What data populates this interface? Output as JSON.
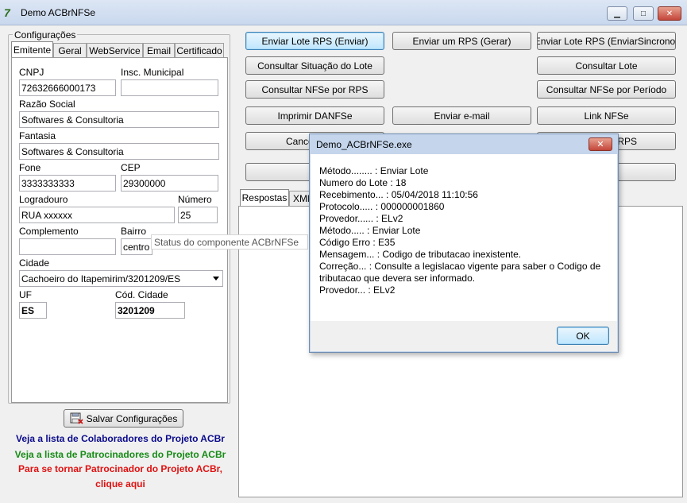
{
  "window": {
    "title": "Demo ACBrNFSe",
    "minimize": "▁",
    "maximize": "□",
    "close": "✕",
    "icon_glyph": "7"
  },
  "config": {
    "group_title": "Configurações",
    "tabs": [
      "Emitente",
      "Geral",
      "WebService",
      "Email",
      "Certificado"
    ],
    "labels": {
      "cnpj": "CNPJ",
      "insc_municipal": "Insc. Municipal",
      "razao_social": "Razão Social",
      "fantasia": "Fantasia",
      "fone": "Fone",
      "cep": "CEP",
      "logradouro": "Logradouro",
      "numero": "Número",
      "complemento": "Complemento",
      "bairro": "Bairro",
      "cidade": "Cidade",
      "uf": "UF",
      "cod_cidade": "Cód. Cidade"
    },
    "values": {
      "cnpj": "72632666000173",
      "insc_municipal": "",
      "razao_social": "Softwares & Consultoria",
      "fantasia": "Softwares & Consultoria",
      "fone": "3333333333",
      "cep": "29300000",
      "logradouro": "RUA xxxxxx",
      "numero": "25",
      "complemento": "",
      "bairro": "centro",
      "cidade": "Cachoeiro do Itapemirim/3201209/ES",
      "uf": "ES",
      "cod_cidade": "3201209"
    },
    "save_button": "Salvar Configurações"
  },
  "links": {
    "colaboradores": "Veja a lista de Colaboradores do Projeto ACBr",
    "patrocinadores": "Veja a lista de Patrocinadores do Projeto ACBr",
    "tornar_1": "Para se tornar Patrocinador do Projeto ACBr,",
    "tornar_2": "clique aqui"
  },
  "actions": {
    "enviar_lote": "Enviar Lote RPS (Enviar)",
    "enviar_um": "Enviar um RPS (Gerar)",
    "enviar_sincrono": "Enviar Lote RPS (EnviarSincrono)",
    "consultar_situacao": "Consultar Situação do Lote",
    "consultar_lote": "Consultar Lote",
    "consultar_nfse_rps": "Consultar NFSe por RPS",
    "consultar_nfse_periodo": "Consultar NFSe por Período",
    "imprimir_danfse": "Imprimir DANFSe",
    "enviar_email": "Enviar e-mail",
    "link_nfse": "Link NFSe",
    "cancelar_partial": "Cance",
    "rps_partial": "RPS"
  },
  "response_tabs": {
    "respostas": "Respostas",
    "xml_partial": "XMl"
  },
  "tooltip": "Status do componente ACBrNFSe",
  "dialog": {
    "title": "Demo_ACBrNFSe.exe",
    "close": "✕",
    "lines": [
      "Método........ : Enviar Lote",
      "Numero do Lote : 18",
      "Recebimento... : 05/04/2018 11:10:56",
      "Protocolo..... : 000000001860",
      "Provedor...... : ELv2",
      "Método..... : Enviar Lote",
      "Código Erro : E35",
      "Mensagem... : Codigo de tributacao inexistente.",
      "Correção... : Consulte a legislacao vigente para saber o Codigo de",
      "tributacao que devera ser informado.",
      "Provedor... : ELv2"
    ],
    "ok_button": "OK"
  },
  "colors": {
    "link_blue": "#0b0b8c",
    "link_green": "#178c17",
    "link_red": "#e01010"
  }
}
